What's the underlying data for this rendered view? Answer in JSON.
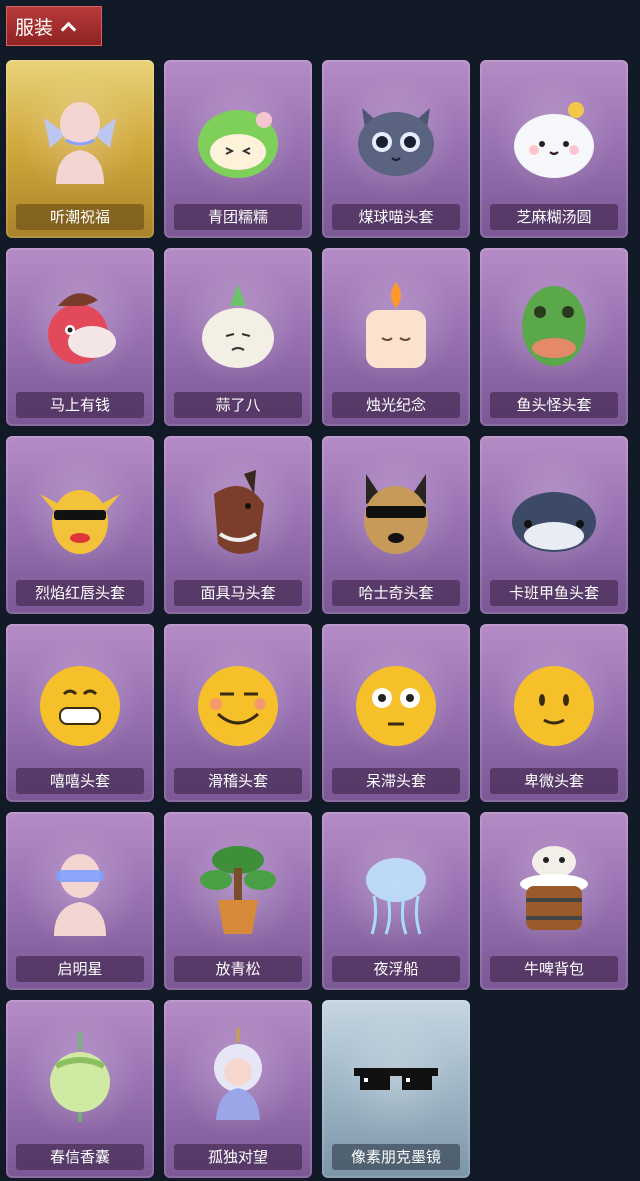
{
  "header": {
    "title": "服装",
    "chevron_icon": "chevron-up-icon"
  },
  "items": [
    {
      "label": "听潮祝福",
      "icon": "pale-avatar-crystal-wings",
      "tier": "gold"
    },
    {
      "label": "青团糯糯",
      "icon": "green-rice-ball-head",
      "tier": "purple"
    },
    {
      "label": "煤球喵头套",
      "icon": "gray-cat-head",
      "tier": "purple"
    },
    {
      "label": "芝麻糊汤圆",
      "icon": "white-dumpling-head",
      "tier": "purple"
    },
    {
      "label": "马上有钱",
      "icon": "red-horse-head",
      "tier": "purple"
    },
    {
      "label": "蒜了八",
      "icon": "garlic-head",
      "tier": "purple"
    },
    {
      "label": "烛光纪念",
      "icon": "candle-head",
      "tier": "purple"
    },
    {
      "label": "鱼头怪头套",
      "icon": "green-fish-head",
      "tier": "purple"
    },
    {
      "label": "烈焰红唇头套",
      "icon": "yellow-pika-mask",
      "tier": "purple"
    },
    {
      "label": "面具马头套",
      "icon": "brown-horse-mask",
      "tier": "purple"
    },
    {
      "label": "哈士奇头套",
      "icon": "husky-head-sunglasses",
      "tier": "purple"
    },
    {
      "label": "卡班甲鱼头套",
      "icon": "blue-fish-head",
      "tier": "purple"
    },
    {
      "label": "嘻嘻头套",
      "icon": "grinning-emoji-head",
      "tier": "purple"
    },
    {
      "label": "滑稽头套",
      "icon": "funny-emoji-head",
      "tier": "purple"
    },
    {
      "label": "呆滞头套",
      "icon": "dazed-emoji-head",
      "tier": "purple"
    },
    {
      "label": "卑微头套",
      "icon": "humble-emoji-head",
      "tier": "purple"
    },
    {
      "label": "启明星",
      "icon": "pale-avatar-blue-mask",
      "tier": "purple"
    },
    {
      "label": "放青松",
      "icon": "bonsai-pine-pot",
      "tier": "purple"
    },
    {
      "label": "夜浮船",
      "icon": "jellyfish-ornament",
      "tier": "purple"
    },
    {
      "label": "牛啤背包",
      "icon": "cow-beer-barrel-backpack",
      "tier": "purple"
    },
    {
      "label": "春信香囊",
      "icon": "green-sachet",
      "tier": "purple"
    },
    {
      "label": "孤独对望",
      "icon": "doll-keychain",
      "tier": "purple"
    },
    {
      "label": "像素朋克墨镜",
      "icon": "pixel-sunglasses",
      "tier": "blue"
    }
  ]
}
